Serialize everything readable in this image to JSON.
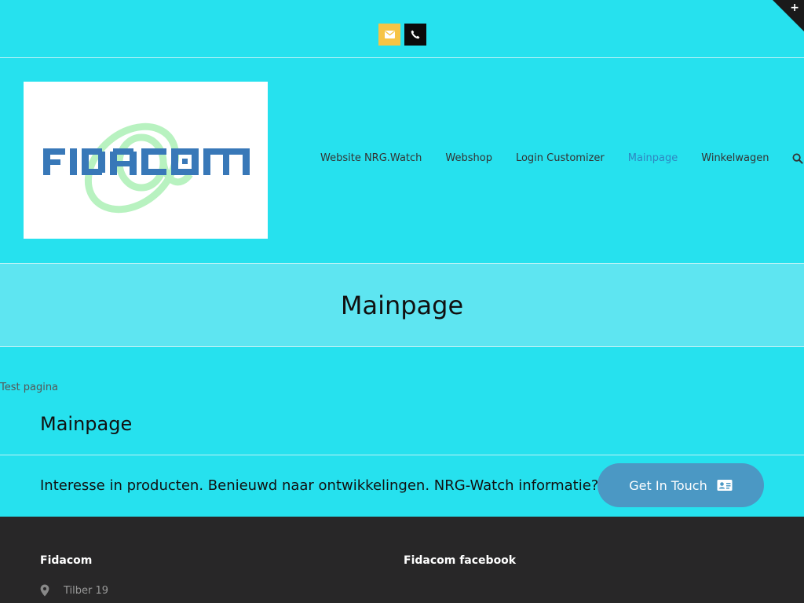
{
  "topbar": {
    "mail_icon": "envelope-icon",
    "phone_icon": "phone-icon",
    "corner_icon": "plus-icon",
    "mail_color": "#f6c445",
    "phone_color": "#0b0b0b"
  },
  "logo": {
    "text": "FIDACOM",
    "text_color": "#3878b8",
    "swirl_color": "#b8f2c0"
  },
  "nav": {
    "items": [
      {
        "label": "Website NRG.Watch"
      },
      {
        "label": "Webshop"
      },
      {
        "label": "Login Customizer"
      },
      {
        "label": "Mainpage",
        "active": true
      },
      {
        "label": "Winkelwagen"
      }
    ],
    "search_icon": "search-icon"
  },
  "title_bar": {
    "title": "Mainpage"
  },
  "content": {
    "intro_text": "Test pagina",
    "heading": "Mainpage"
  },
  "cta": {
    "text": "Interesse in producten. Benieuwd naar ontwikkelingen. NRG-Watch informatie?",
    "button_label": "Get In Touch",
    "button_icon": "contact-card-icon",
    "button_color": "#4b98c4"
  },
  "footer": {
    "left_heading": "Fidacom",
    "right_heading": "Fidacom facebook",
    "address": "Tilber 19",
    "address_icon": "map-pin-icon"
  },
  "colors": {
    "page_bg": "#26e1ee",
    "title_bar_bg": "#5ee5f1",
    "footer_bg": "#282728",
    "active_nav": "#2f86c0"
  }
}
